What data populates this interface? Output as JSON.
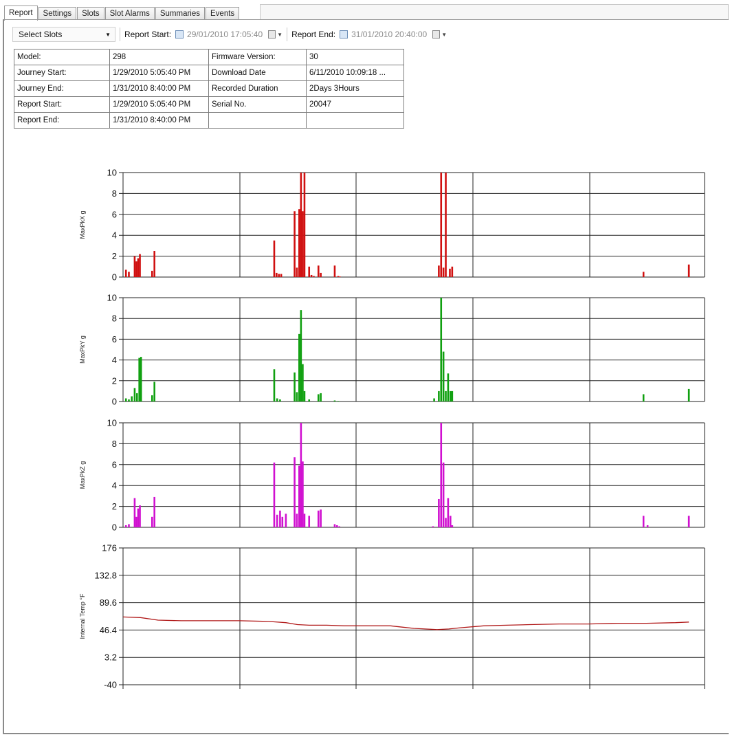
{
  "tabs": [
    "Report",
    "Settings",
    "Slots",
    "Slot Alarms",
    "Summaries",
    "Events"
  ],
  "active_tab": "Report",
  "toolbar": {
    "select_slots": "Select Slots",
    "report_start_label": "Report Start:",
    "report_start_value": "29/01/2010 17:05:40",
    "report_end_label": "Report End:",
    "report_end_value": "31/01/2010 20:40:00",
    "icons": [
      "calendar-icon",
      "grid-dropdown-icon"
    ]
  },
  "info_table": [
    [
      "Model:",
      "298",
      "Firmware Version:",
      "30"
    ],
    [
      "Journey Start:",
      "1/29/2010 5:05:40 PM",
      "Download Date",
      "6/11/2010 10:09:18 ..."
    ],
    [
      "Journey End:",
      "1/31/2010 8:40:00 PM",
      "Recorded Duration",
      "2Days 3Hours"
    ],
    [
      "Report Start:",
      "1/29/2010 5:05:40 PM",
      "Serial No.",
      "20047"
    ],
    [
      "Report End:",
      "1/31/2010 8:40:00 PM",
      "",
      ""
    ]
  ],
  "chart_data": [
    {
      "type": "bar",
      "ylabel": "MaxPkX g",
      "color": "#d01010",
      "ylim": [
        0,
        10
      ],
      "yticks": [
        "10",
        "8",
        "6",
        "4",
        "2",
        "0"
      ],
      "x_range": [
        0,
        100
      ],
      "x": [
        0.5,
        1.0,
        2.0,
        2.3,
        2.6,
        2.9,
        5.0,
        5.4,
        26.0,
        26.4,
        26.8,
        27.2,
        29.5,
        29.9,
        30.3,
        30.6,
        30.9,
        31.2,
        32.0,
        32.4,
        32.8,
        33.6,
        34.0,
        36.4,
        37.0,
        37.3,
        54.3,
        54.7,
        55.1,
        55.5,
        56.2,
        56.6,
        89.5,
        97.3
      ],
      "values": [
        0.7,
        0.5,
        2.0,
        1.5,
        1.8,
        2.2,
        0.6,
        2.5,
        3.5,
        0.4,
        0.3,
        0.3,
        6.3,
        0.9,
        6.5,
        10,
        6.3,
        10,
        1.0,
        0.2,
        0.1,
        1.1,
        0.4,
        1.1,
        0.1,
        0.05,
        1.1,
        10,
        0.9,
        10,
        0.8,
        1.0,
        0.5,
        1.2
      ]
    },
    {
      "type": "bar",
      "ylabel": "MaxPkY g",
      "color": "#10a010",
      "ylim": [
        0,
        10
      ],
      "yticks": [
        "10",
        "8",
        "6",
        "4",
        "2",
        "0"
      ],
      "x_range": [
        0,
        100
      ],
      "x": [
        0.5,
        1.0,
        1.5,
        2.0,
        2.4,
        2.8,
        3.1,
        5.0,
        5.4,
        26.0,
        26.5,
        27.0,
        29.5,
        29.9,
        30.3,
        30.6,
        30.9,
        31.2,
        32.0,
        33.6,
        34.0,
        36.4,
        37.0,
        53.5,
        54.3,
        54.7,
        55.1,
        55.5,
        55.9,
        56.3,
        56.6,
        89.5,
        97.3
      ],
      "values": [
        0.3,
        0.2,
        0.5,
        1.3,
        0.8,
        4.2,
        4.3,
        0.6,
        1.9,
        3.1,
        0.3,
        0.2,
        2.8,
        0.9,
        6.5,
        8.8,
        3.6,
        1.0,
        0.2,
        0.7,
        0.8,
        0.1,
        0.05,
        0.3,
        1.0,
        10,
        4.8,
        1.0,
        2.7,
        1.0,
        1.0,
        0.7,
        1.2
      ]
    },
    {
      "type": "bar",
      "ylabel": "MaxPkZ g",
      "color": "#d010d0",
      "ylim": [
        0,
        10
      ],
      "yticks": [
        "10",
        "8",
        "6",
        "4",
        "2",
        "0"
      ],
      "x_range": [
        0,
        100
      ],
      "x": [
        0.5,
        1.0,
        2.0,
        2.3,
        2.6,
        2.9,
        5.0,
        5.4,
        26.0,
        26.5,
        27.0,
        27.4,
        28.0,
        29.5,
        29.9,
        30.3,
        30.6,
        30.9,
        31.2,
        32.0,
        33.6,
        34.0,
        36.4,
        36.8,
        37.2,
        53.3,
        54.3,
        54.7,
        55.1,
        55.5,
        55.9,
        56.3,
        56.6,
        89.5,
        90.2,
        97.3
      ],
      "values": [
        0.2,
        0.3,
        2.8,
        1.0,
        1.8,
        2.1,
        1.0,
        2.9,
        6.2,
        1.2,
        1.6,
        1.0,
        1.3,
        6.7,
        1.3,
        5.9,
        10,
        6.3,
        1.3,
        1.1,
        1.6,
        1.7,
        0.3,
        0.2,
        0.1,
        0.1,
        2.7,
        10,
        6.2,
        0.9,
        2.8,
        1.1,
        0.2,
        1.1,
        0.2,
        1.1
      ]
    },
    {
      "type": "line",
      "ylabel": "Internal Temp °F",
      "color": "#b01818",
      "ylim": [
        -40,
        176
      ],
      "yticks": [
        "176",
        "132.8",
        "89.6",
        "46.4",
        "3.2",
        "-40"
      ],
      "x_range": [
        0,
        100
      ],
      "x": [
        0,
        3,
        6,
        10,
        15,
        20,
        25,
        28,
        30,
        32,
        35,
        38,
        40,
        43,
        46,
        48,
        50,
        52,
        54,
        56,
        58,
        62,
        66,
        70,
        75,
        80,
        85,
        90,
        95,
        97.3
      ],
      "values": [
        67,
        66,
        62,
        61,
        61,
        61,
        60,
        58,
        55,
        54,
        54,
        53,
        53,
        53,
        53,
        51,
        49,
        48,
        47,
        48,
        50,
        53,
        54,
        55,
        56,
        56,
        57,
        57,
        58,
        59
      ]
    }
  ]
}
